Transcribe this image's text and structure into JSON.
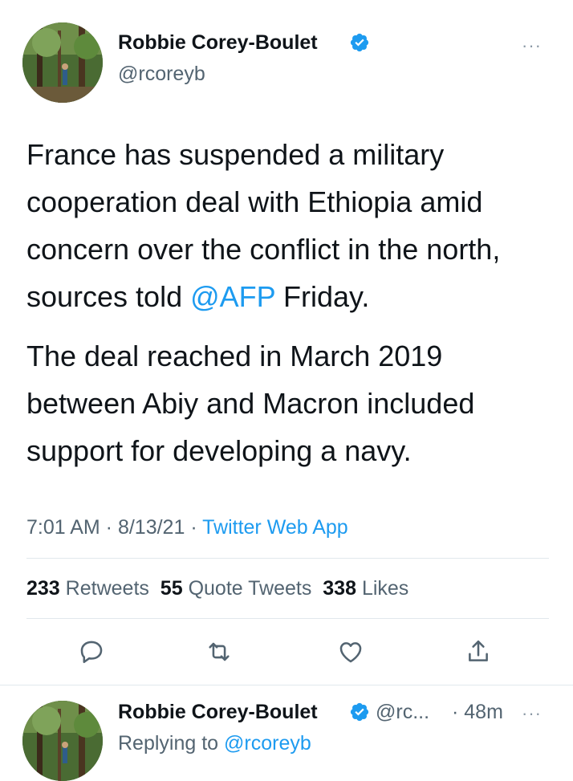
{
  "tweet": {
    "author_name": "Robbie Corey-Boulet",
    "author_handle": "@rcoreyb",
    "more_label": "···",
    "paragraph1_text": "France has suspended a military cooperation deal with Ethiopia amid concern over the conflict in the north, sources told ",
    "paragraph1_mention": "@AFP",
    "paragraph1_tail": " Friday.",
    "paragraph2": "The deal reached in March 2019 between Abiy and Macron included support for developing a navy.",
    "time": "7:01 AM",
    "date": "8/13/21",
    "source": "Twitter Web App",
    "sep": " · "
  },
  "stats": {
    "retweets_count": "233",
    "retweets_label": "Retweets",
    "quotes_count": "55",
    "quotes_label": "Quote Tweets",
    "likes_count": "338",
    "likes_label": "Likes"
  },
  "actions": [
    "reply-icon",
    "retweet-icon",
    "like-icon",
    "share-icon"
  ],
  "reply": {
    "author_name": "Robbie Corey-Boulet",
    "author_handle": "@rc...",
    "age": "· 48m",
    "more_label": "···",
    "replying_prefix": "Replying to ",
    "replying_handle": "@rcoreyb"
  },
  "colors": {
    "link": "#1d9bf0",
    "verified": "#1d9bf0",
    "secondary_text": "#536471"
  }
}
